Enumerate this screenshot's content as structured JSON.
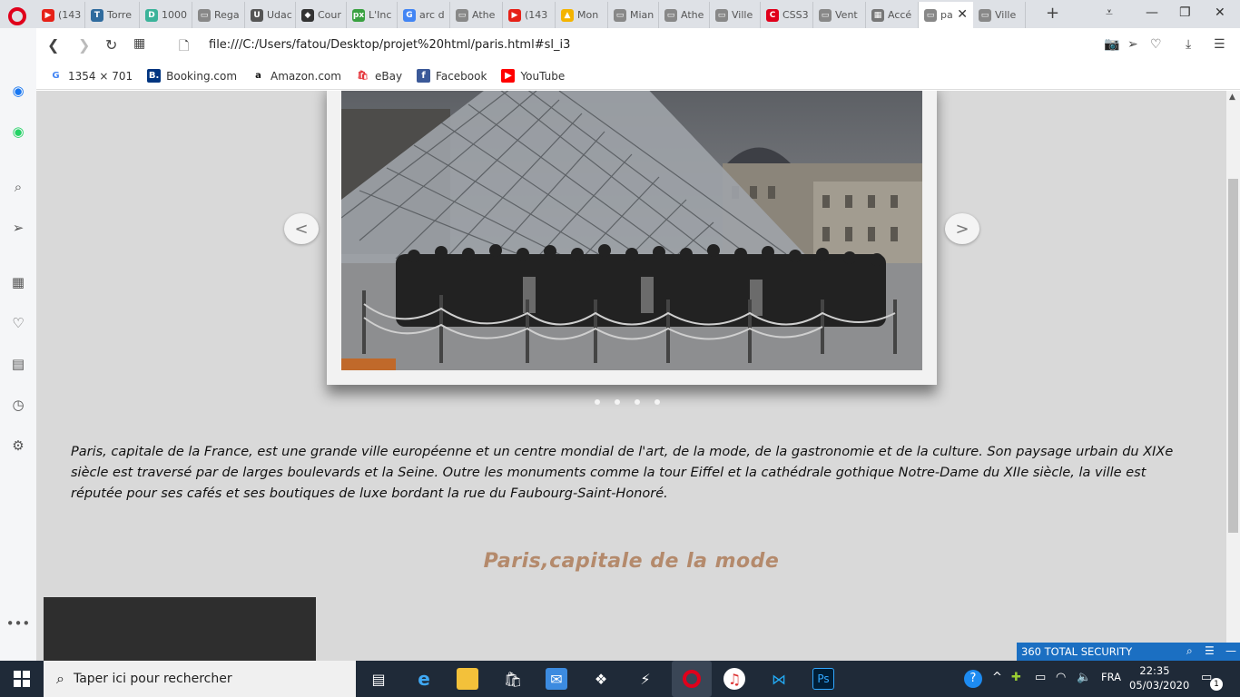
{
  "tabs": [
    {
      "label": "(143",
      "color": "#e62117",
      "glyph": "▶"
    },
    {
      "label": "Torre",
      "color": "#2f6b9e",
      "glyph": "T"
    },
    {
      "label": "1000",
      "color": "#3bb39a",
      "glyph": "D"
    },
    {
      "label": "Rega",
      "color": "#888888",
      "glyph": "▭"
    },
    {
      "label": "Udac",
      "color": "#555555",
      "glyph": "U"
    },
    {
      "label": "Cour",
      "color": "#333333",
      "glyph": "◆"
    },
    {
      "label": "L'Inc",
      "color": "#3aa141",
      "glyph": "px"
    },
    {
      "label": "arc d",
      "color": "#4285f4",
      "glyph": "G"
    },
    {
      "label": "Athe",
      "color": "#888888",
      "glyph": "▭"
    },
    {
      "label": "(143",
      "color": "#e62117",
      "glyph": "▶"
    },
    {
      "label": "Mon",
      "color": "#f4b400",
      "glyph": "▲"
    },
    {
      "label": "Mian",
      "color": "#888888",
      "glyph": "▭"
    },
    {
      "label": "Athe",
      "color": "#888888",
      "glyph": "▭"
    },
    {
      "label": "Ville",
      "color": "#888888",
      "glyph": "▭"
    },
    {
      "label": "CSS3",
      "color": "#e0001b",
      "glyph": "C"
    },
    {
      "label": "Vent",
      "color": "#888888",
      "glyph": "▭"
    },
    {
      "label": "Accé",
      "color": "#777777",
      "glyph": "▦"
    },
    {
      "label": "pa",
      "color": "#888888",
      "glyph": "▭",
      "active": true
    },
    {
      "label": "Ville",
      "color": "#888888",
      "glyph": "▭"
    }
  ],
  "address": {
    "url": "file:///C:/Users/fatou/Desktop/projet%20html/paris.html#sl_i3"
  },
  "bookmarks": [
    {
      "label": "1354 × 701",
      "color": "#ffffff",
      "glyph": "G",
      "glyphColor": "#4285f4"
    },
    {
      "label": "Booking.com",
      "color": "#003580",
      "glyph": "B.",
      "glyphColor": "#ffffff"
    },
    {
      "label": "Amazon.com",
      "color": "#ffffff",
      "glyph": "a",
      "glyphColor": "#111111"
    },
    {
      "label": "eBay",
      "color": "#ffffff",
      "glyph": "🛍",
      "glyphColor": "#e53238"
    },
    {
      "label": "Facebook",
      "color": "#3b5998",
      "glyph": "f",
      "glyphColor": "#ffffff"
    },
    {
      "label": "YouTube",
      "color": "#ff0000",
      "glyph": "▶",
      "glyphColor": "#ffffff"
    }
  ],
  "slider": {
    "prev": "<",
    "next": ">",
    "dots": 4
  },
  "content": {
    "intro": "Paris, capitale de la France, est une grande ville européenne et un centre mondial de l'art, de la mode, de la gastronomie et de la culture. Son paysage urbain du XIXe siècle est traversé par de larges boulevards et la Seine. Outre les monuments comme la tour Eiffel et la cathédrale gothique Notre-Dame du XIIe siècle, la ville est réputée pour ses cafés et ses boutiques de luxe bordant la rue du Faubourg-Saint-Honoré.",
    "section_title": "Paris,capitale  de  la  mode"
  },
  "security": {
    "label": "360 TOTAL SECURITY"
  },
  "taskbar": {
    "search_placeholder": "Taper ici pour rechercher",
    "lang": "FRA",
    "time": "22:35",
    "date": "05/03/2020",
    "notif_count": "1"
  }
}
